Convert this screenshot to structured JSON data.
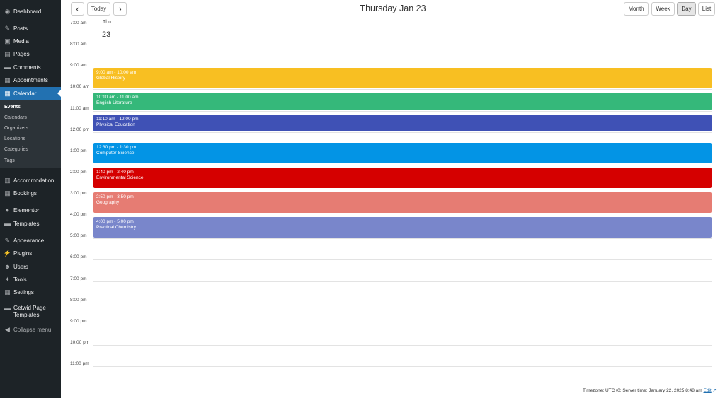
{
  "sidebar": {
    "items": [
      {
        "label": "Dashboard",
        "icon": "dashboard-icon",
        "glyph": "◉"
      },
      {
        "label": "Posts",
        "icon": "pin-icon",
        "glyph": "✎"
      },
      {
        "label": "Media",
        "icon": "media-icon",
        "glyph": "▣"
      },
      {
        "label": "Pages",
        "icon": "pages-icon",
        "glyph": "▤"
      },
      {
        "label": "Comments",
        "icon": "comments-icon",
        "glyph": "▬"
      },
      {
        "label": "Appointments",
        "icon": "calendar-icon",
        "glyph": "▦"
      },
      {
        "label": "Calendar",
        "icon": "calendar-icon",
        "glyph": "▦"
      },
      {
        "label": "Accommodation",
        "icon": "building-icon",
        "glyph": "▥"
      },
      {
        "label": "Bookings",
        "icon": "calendar-icon",
        "glyph": "▦"
      },
      {
        "label": "Elementor",
        "icon": "elementor-icon",
        "glyph": "●"
      },
      {
        "label": "Templates",
        "icon": "folder-icon",
        "glyph": "▬"
      },
      {
        "label": "Appearance",
        "icon": "brush-icon",
        "glyph": "✎"
      },
      {
        "label": "Plugins",
        "icon": "plug-icon",
        "glyph": "⚡"
      },
      {
        "label": "Users",
        "icon": "user-icon",
        "glyph": "☻"
      },
      {
        "label": "Tools",
        "icon": "wrench-icon",
        "glyph": "✦"
      },
      {
        "label": "Settings",
        "icon": "settings-icon",
        "glyph": "▦"
      },
      {
        "label": "Getwid Page",
        "label2": "Templates",
        "icon": "templates-icon",
        "glyph": "▬"
      },
      {
        "label": "Collapse menu",
        "icon": "collapse-icon",
        "glyph": "◀"
      }
    ],
    "submenu": [
      "Events",
      "Calendars",
      "Organizers",
      "Locations",
      "Categories",
      "Tags"
    ]
  },
  "toolbar": {
    "prev_glyph": "‹",
    "next_glyph": "›",
    "today_label": "Today",
    "title": "Thursday Jan 23",
    "views": [
      "Month",
      "Week",
      "Day",
      "List"
    ],
    "active_view": "Day"
  },
  "day_header": {
    "weekday": "Thu",
    "day": "23"
  },
  "time_labels": [
    "7:00 am",
    "8:00 am",
    "9:00 am",
    "10:00 am",
    "11:00 am",
    "12:00 pm",
    "1:00 pm",
    "2:00 pm",
    "3:00 pm",
    "4:00 pm",
    "5:00 pm",
    "6:00 pm",
    "7:00 pm",
    "8:00 pm",
    "9:00 pm",
    "10:00 pm",
    "11:00 pm"
  ],
  "events": [
    {
      "time": "9:00 am - 10:00 am",
      "title": "Global History",
      "color": "#f8bf22",
      "start": 9.0,
      "end": 10.0
    },
    {
      "time": "10:10 am - 11:00 am",
      "title": "English Literature",
      "color": "#35b87a",
      "start": 10.1667,
      "end": 11.0
    },
    {
      "time": "11:10 am - 12:00 pm",
      "title": "Physical Education",
      "color": "#3f51b5",
      "start": 11.1667,
      "end": 12.0
    },
    {
      "time": "12:30 pm - 1:30 pm",
      "title": "Computer Science",
      "color": "#0394e5",
      "start": 12.5,
      "end": 13.5
    },
    {
      "time": "1:40 pm - 2:40 pm",
      "title": "Environmental Science",
      "color": "#d50000",
      "start": 13.6667,
      "end": 14.6667
    },
    {
      "time": "2:50 pm - 3:50 pm",
      "title": "Geography",
      "color": "#e67c73",
      "start": 14.8333,
      "end": 15.8333
    },
    {
      "time": "4:00 pm - 5:00 pm",
      "title": "Practical Chemistry",
      "color": "#7986cb",
      "start": 16.0,
      "end": 17.0
    }
  ],
  "footer": {
    "text": "Timezone: UTC+0; Server time: January 22, 2025 8:48 am",
    "edit_label": "Edit",
    "edit_glyph": "↗"
  }
}
